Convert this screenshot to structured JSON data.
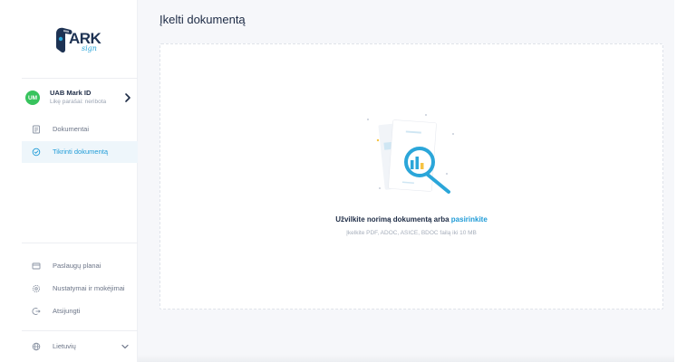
{
  "brand": {
    "logo_text": "ARK",
    "logo_script": "sign",
    "accent": "#2ba6d9",
    "navy": "#1d3253"
  },
  "account": {
    "initials": "UM",
    "name": "UAB Mark ID",
    "subtitle": "Likę parašai: neribota",
    "avatar_color": "#37c35d"
  },
  "nav_top": [
    {
      "label": "Dokumentai",
      "icon": "document-icon",
      "active": false
    },
    {
      "label": "Tikrinti dokumentą",
      "icon": "check-circle-icon",
      "active": true
    }
  ],
  "nav_bottom": [
    {
      "label": "Paslaugų planai",
      "icon": "card-icon"
    },
    {
      "label": "Nustatymai ir mokėjimai",
      "icon": "gear-icon"
    },
    {
      "label": "Atsijungti",
      "icon": "logout-icon"
    }
  ],
  "language": {
    "label": "Lietuvių",
    "icon": "globe-icon"
  },
  "page": {
    "title": "Įkelti dokumentą"
  },
  "dropzone": {
    "prompt": "Užvilkite norimą dokumentą arba ",
    "link": "pasirinkite",
    "hint": "Įkelkite PDF, ADOC, ASICE, BDOC failą iki 10 MB"
  }
}
